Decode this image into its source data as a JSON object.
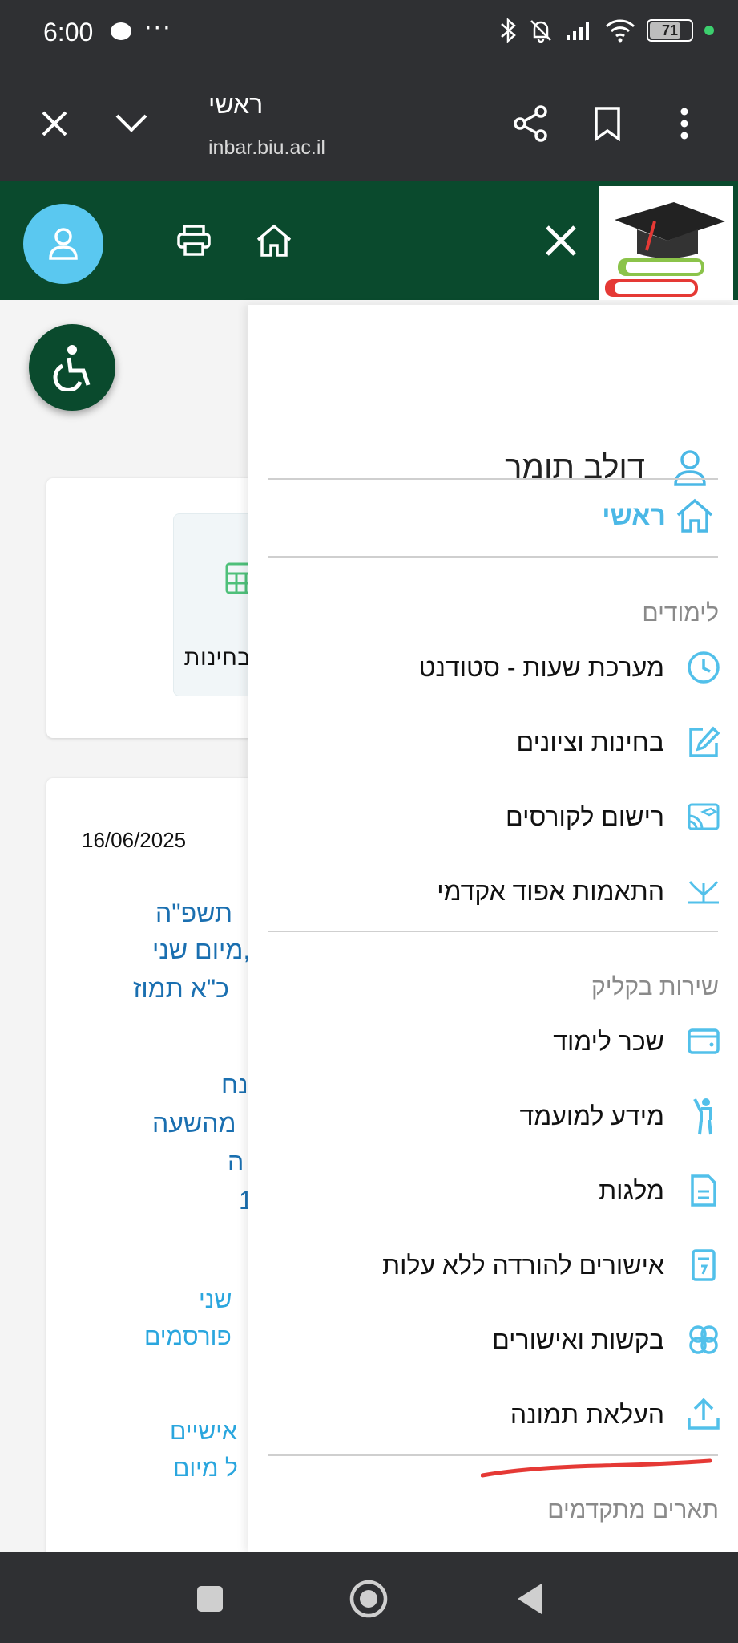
{
  "status_bar": {
    "time": "6:00",
    "more": "···",
    "battery": "71"
  },
  "browser": {
    "title": "ראשי",
    "url": "inbar.biu.ac.il"
  },
  "background": {
    "card1_label": "בחינות",
    "date": "16/06/2025",
    "lines_dark": [
      "תשפ\"ה",
      "מיום שני,",
      "כ\"א תמוז",
      "נח",
      "מהשעה",
      "ה",
      "1"
    ],
    "lines_light": [
      "שני",
      "פורסמים",
      "אישיים",
      "ל מיום"
    ]
  },
  "drawer": {
    "user_name": "דולב תומר",
    "home": "ראשי",
    "section_studies": "לימודים",
    "studies": [
      {
        "label": "מערכת שעות - סטודנט",
        "icon": "clock-icon"
      },
      {
        "label": "בחינות וציונים",
        "icon": "edit-icon"
      },
      {
        "label": "רישום לקורסים",
        "icon": "cast-icon"
      },
      {
        "label": "התאמות אפוד אקדמי",
        "icon": "growth-icon"
      }
    ],
    "section_service": "שירות בקליק",
    "service": [
      {
        "label": "שכר לימוד",
        "icon": "wallet-icon"
      },
      {
        "label": "מידע למועמד",
        "icon": "person-raise-icon"
      },
      {
        "label": "מלגות",
        "icon": "document-icon"
      },
      {
        "label": "אישורים להורדה ללא עלות",
        "icon": "receipt-icon"
      },
      {
        "label": "בקשות ואישורים",
        "icon": "flower-icon"
      },
      {
        "label": "העלאת תמונה",
        "icon": "upload-icon"
      }
    ],
    "section_advanced": "תארים מתקדמים"
  },
  "colors": {
    "header_green": "#0a4a2d",
    "accent_blue": "#4bb8e6",
    "icon_blue": "#52c0ea",
    "dark_bar": "#2f3033"
  }
}
